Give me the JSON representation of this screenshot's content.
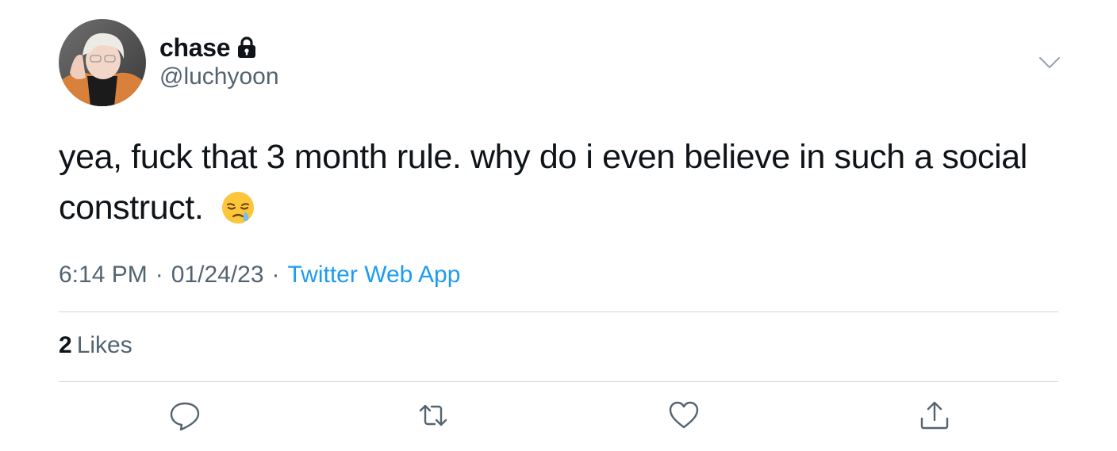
{
  "author": {
    "display_name": "chase",
    "handle": "@luchyoon",
    "protected_icon": "lock-icon",
    "avatar": "profile-photo"
  },
  "tweet": {
    "text": "yea, fuck that 3 month rule. why do i even believe in such a social construct.",
    "emoji": "sleepy-face-emoji"
  },
  "meta": {
    "time": "6:14 PM",
    "separator": "·",
    "date": "01/24/23",
    "source": "Twitter Web App"
  },
  "stats": {
    "likes_count": "2",
    "likes_label": "Likes"
  },
  "actions": {
    "reply_icon": "reply-icon",
    "retweet_icon": "retweet-icon",
    "like_icon": "heart-icon",
    "share_icon": "share-icon",
    "more_icon": "chevron-down-icon"
  },
  "colors": {
    "text_primary": "#0f1419",
    "text_secondary": "#536471",
    "link": "#1d9bf0",
    "divider": "#cfd9de"
  }
}
